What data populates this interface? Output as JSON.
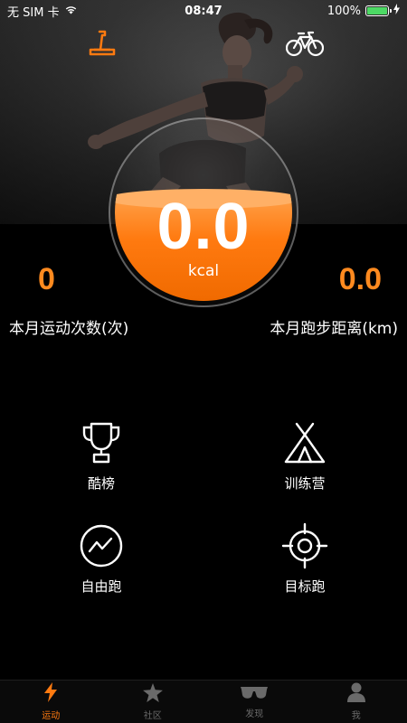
{
  "status_bar": {
    "carrier": "无 SIM 卡",
    "time": "08:47",
    "battery": "100%",
    "battery_level": 1.0
  },
  "mode_icons": {
    "left": "treadmill-icon",
    "right": "bicycle-icon"
  },
  "gauge": {
    "value": "0.0",
    "unit": "kcal",
    "fill_level": 0.58
  },
  "stats": {
    "left": {
      "value": "0",
      "label": "本月运动次数(次)"
    },
    "right": {
      "value": "0.0",
      "label": "本月跑步距离(km)"
    }
  },
  "features": [
    {
      "label": "酷榜",
      "icon": "trophy-icon"
    },
    {
      "label": "训练营",
      "icon": "tent-icon"
    },
    {
      "label": "自由跑",
      "icon": "free-run-icon"
    },
    {
      "label": "目标跑",
      "icon": "target-icon"
    }
  ],
  "tabbar": {
    "tabs": [
      {
        "label": "运动",
        "icon": "lightning-icon",
        "active": true
      },
      {
        "label": "社区",
        "icon": "star-icon",
        "active": false
      },
      {
        "label": "发现",
        "icon": "glasses-icon",
        "active": false
      },
      {
        "label": "我",
        "icon": "person-icon",
        "active": false
      }
    ]
  },
  "colors": {
    "accent": "#ff7a10",
    "stat_value": "#ff8a1f",
    "battery_fill": "#4cd964",
    "tab_inactive": "#6a6a6a"
  }
}
